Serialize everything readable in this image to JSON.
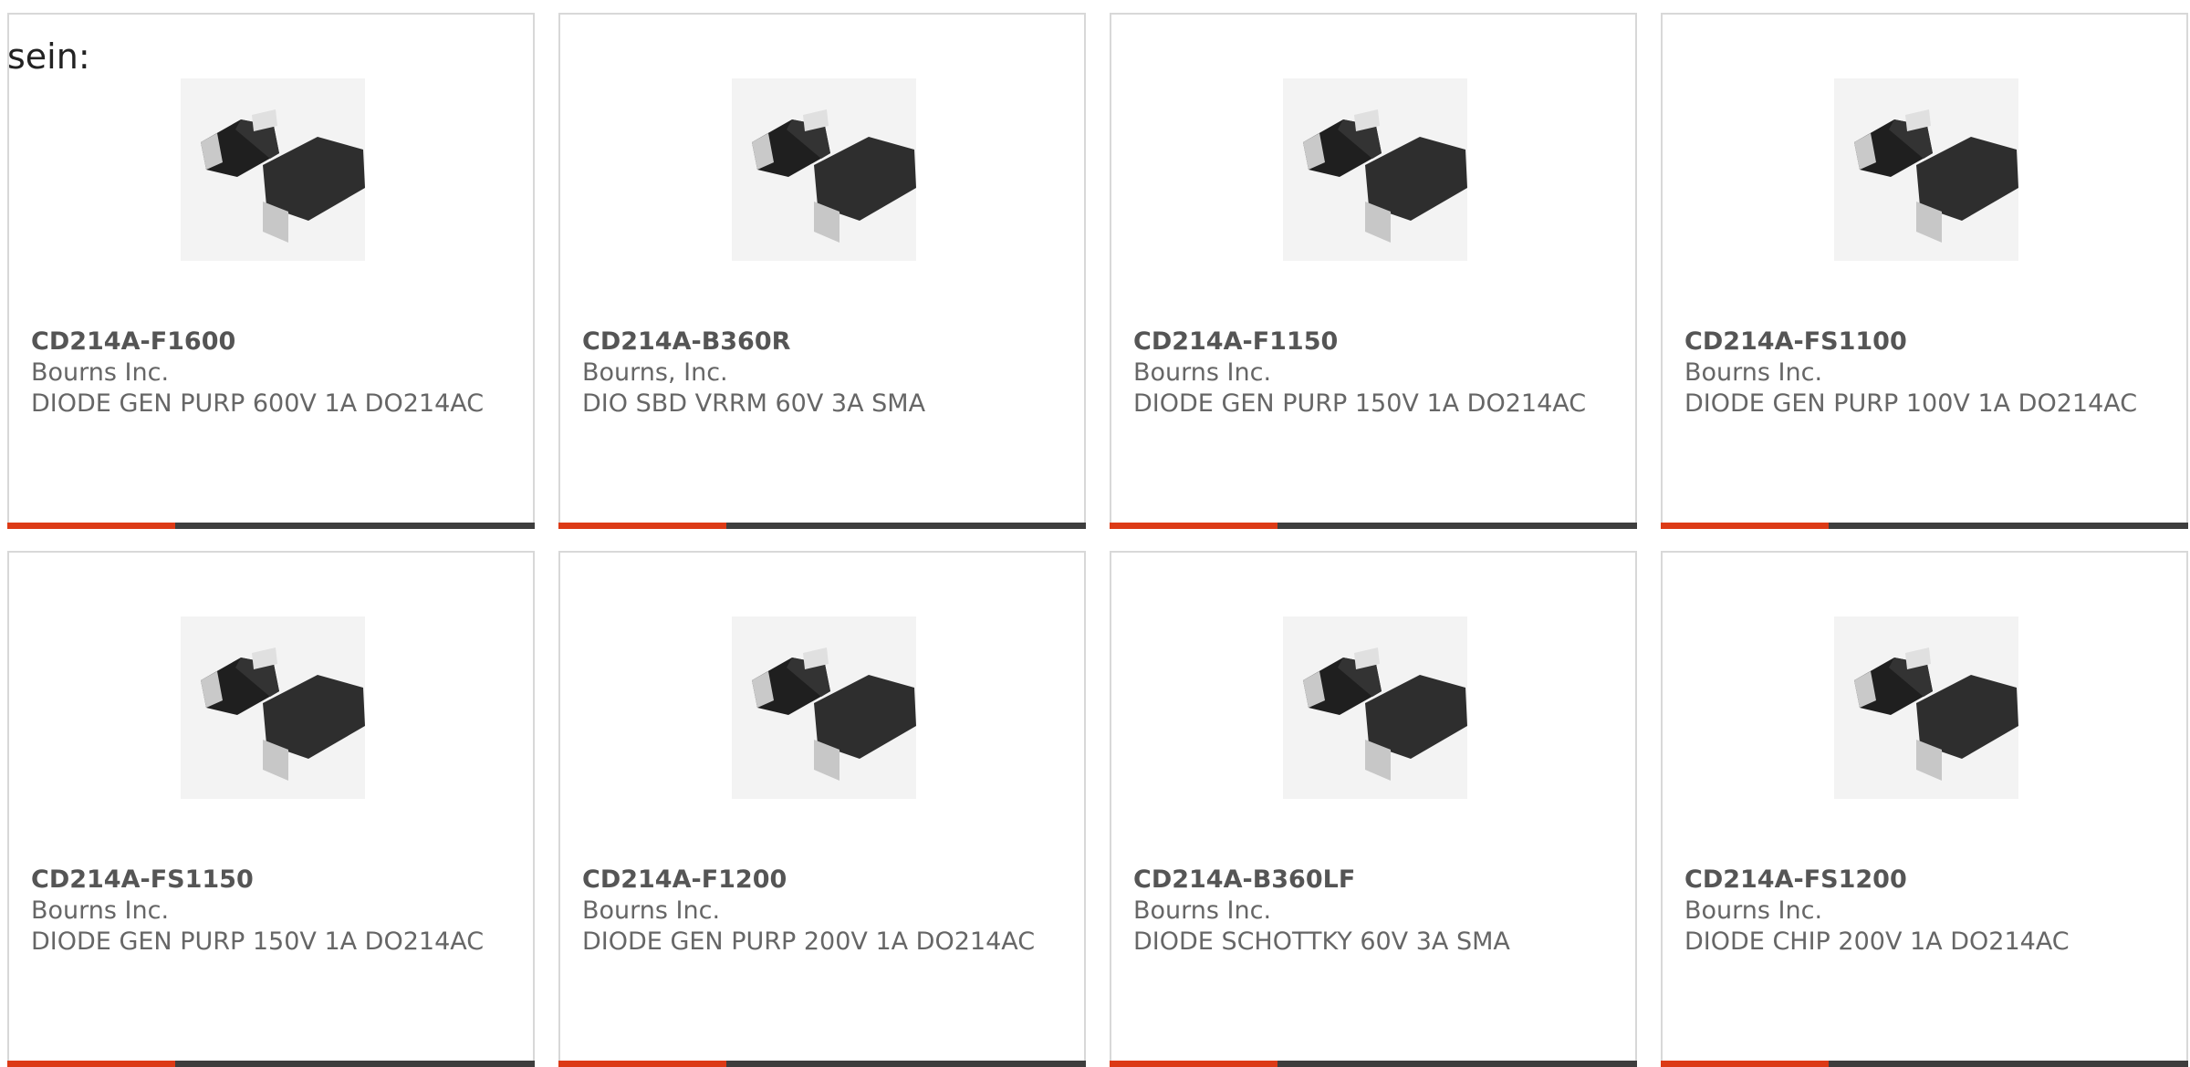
{
  "intro_text": "sein:",
  "products": [
    {
      "part_number": "CD214A-F1600",
      "manufacturer": "Bourns Inc.",
      "description": "DIODE GEN PURP 600V 1A DO214AC"
    },
    {
      "part_number": "CD214A-B360R",
      "manufacturer": "Bourns, Inc.",
      "description": "DIO SBD VRRM 60V 3A SMA"
    },
    {
      "part_number": "CD214A-F1150",
      "manufacturer": "Bourns Inc.",
      "description": "DIODE GEN PURP 150V 1A DO214AC"
    },
    {
      "part_number": "CD214A-FS1100",
      "manufacturer": "Bourns Inc.",
      "description": "DIODE GEN PURP 100V 1A DO214AC"
    },
    {
      "part_number": "CD214A-FS1150",
      "manufacturer": "Bourns Inc.",
      "description": "DIODE GEN PURP 150V 1A DO214AC"
    },
    {
      "part_number": "CD214A-F1200",
      "manufacturer": "Bourns Inc.",
      "description": "DIODE GEN PURP 200V 1A DO214AC"
    },
    {
      "part_number": "CD214A-B360LF",
      "manufacturer": "Bourns Inc.",
      "description": "DIODE SCHOTTKY 60V 3A SMA"
    },
    {
      "part_number": "CD214A-FS1200",
      "manufacturer": "Bourns Inc.",
      "description": "DIODE CHIP 200V 1A DO214AC"
    }
  ],
  "colors": {
    "accent": "#dc3a16",
    "bar": "#3e3e3e",
    "border": "#d8d8d8",
    "text": "#666666"
  }
}
